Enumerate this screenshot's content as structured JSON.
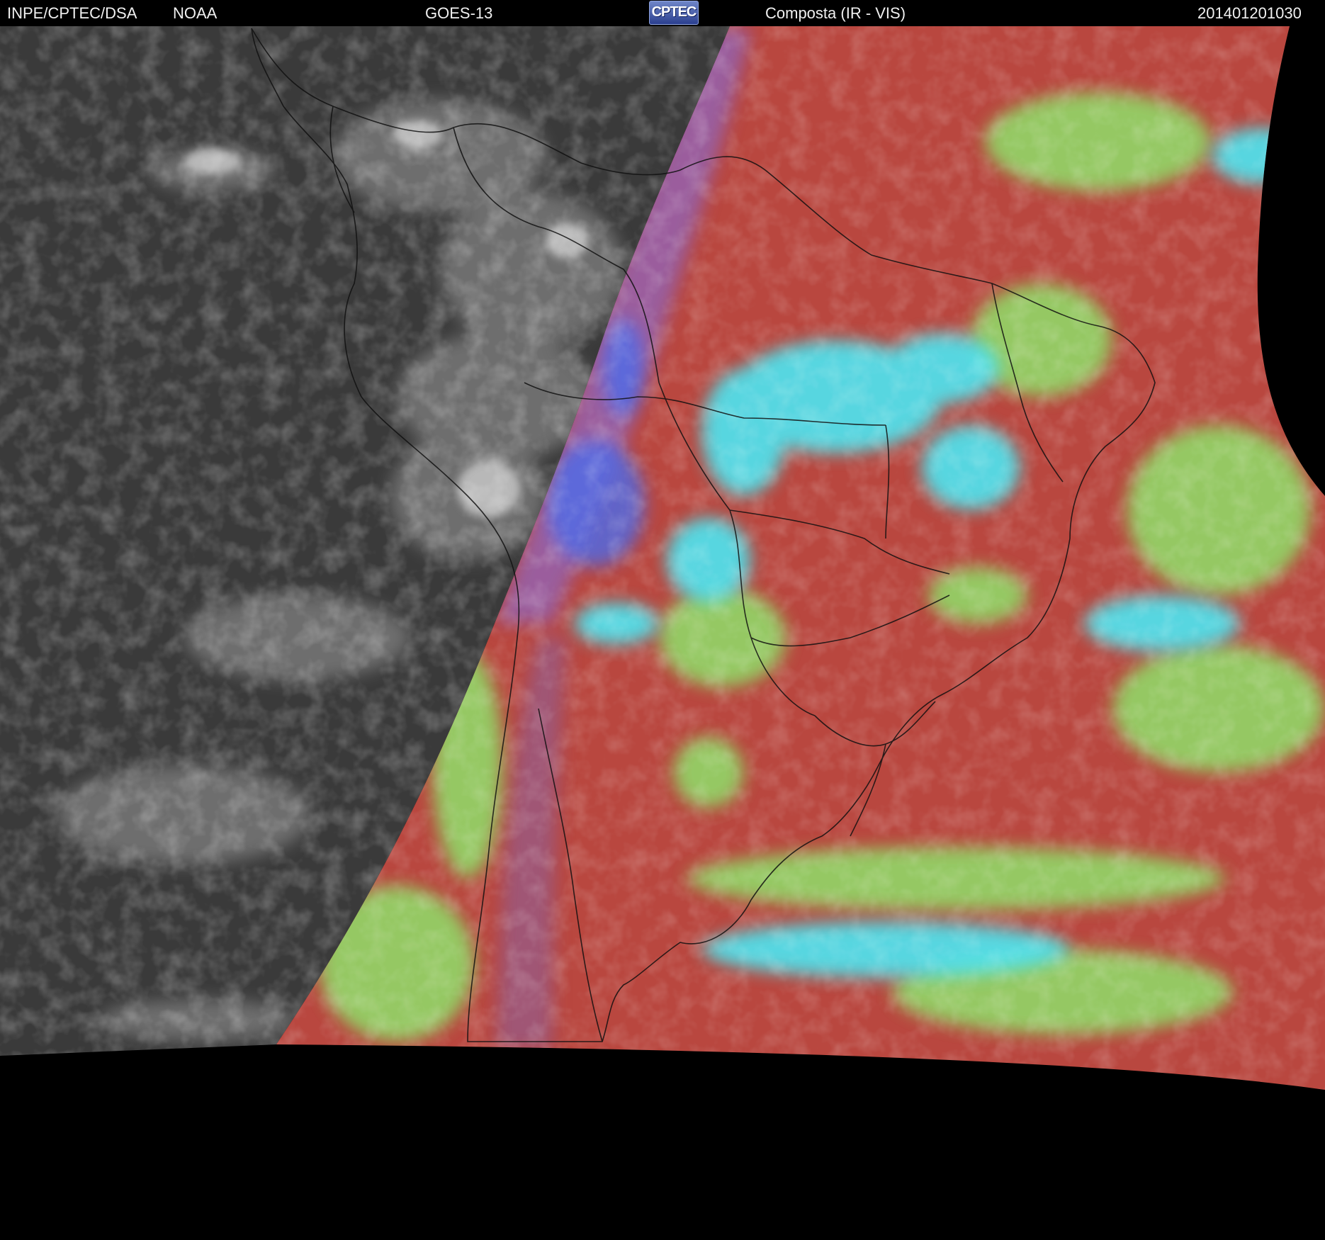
{
  "header": {
    "source": "INPE/CPTEC/DSA",
    "agency": "NOAA",
    "satellite": "GOES-13",
    "logo_text": "CPTEC",
    "product": "Composta (IR - VIS)",
    "datetime": "201401201030"
  },
  "colors": {
    "background": "#000000",
    "ir_dark_ocean": "#3d3d3d",
    "ir_cloud": "#bcbcbc",
    "vis_land_ocean_red": "#b9473f",
    "vis_low_cloud_green": "#8fe06a",
    "vis_high_cloud_cyan": "#4ee6f2",
    "vis_twilight_blue": "#5a6ee0",
    "borders": "#111111"
  }
}
